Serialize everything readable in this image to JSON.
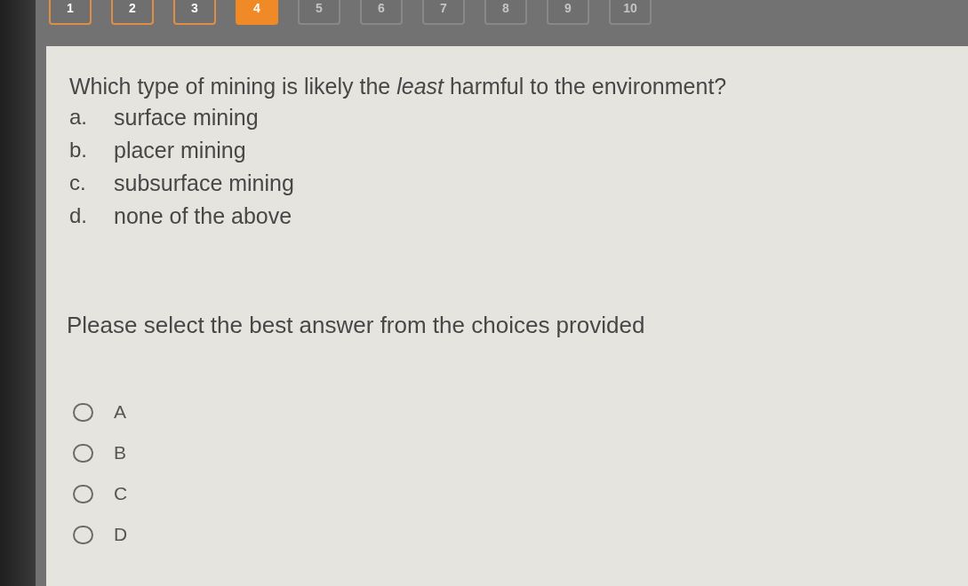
{
  "question_nav": [
    {
      "label": "1",
      "selected": false,
      "visited": true
    },
    {
      "label": "2",
      "selected": false,
      "visited": true
    },
    {
      "label": "3",
      "selected": false,
      "visited": true
    },
    {
      "label": "4",
      "selected": true,
      "visited": true
    },
    {
      "label": "5",
      "selected": false,
      "visited": false
    },
    {
      "label": "6",
      "selected": false,
      "visited": false
    },
    {
      "label": "7",
      "selected": false,
      "visited": false
    },
    {
      "label": "8",
      "selected": false,
      "visited": false
    },
    {
      "label": "9",
      "selected": false,
      "visited": false
    },
    {
      "label": "10",
      "selected": false,
      "visited": false
    }
  ],
  "question": {
    "text": "Which type of mining is likely the *least* harmful to the environment?",
    "choices": [
      {
        "letter": "a.",
        "text": "surface mining"
      },
      {
        "letter": "b.",
        "text": "placer mining"
      },
      {
        "letter": "c.",
        "text": "subsurface mining"
      },
      {
        "letter": "d.",
        "text": "none of the above"
      }
    ]
  },
  "instruction": "Please select the best answer from the choices provided",
  "answers": [
    {
      "label": "A",
      "selected": false
    },
    {
      "label": "B",
      "selected": false
    },
    {
      "label": "C",
      "selected": false
    },
    {
      "label": "D",
      "selected": false
    }
  ]
}
